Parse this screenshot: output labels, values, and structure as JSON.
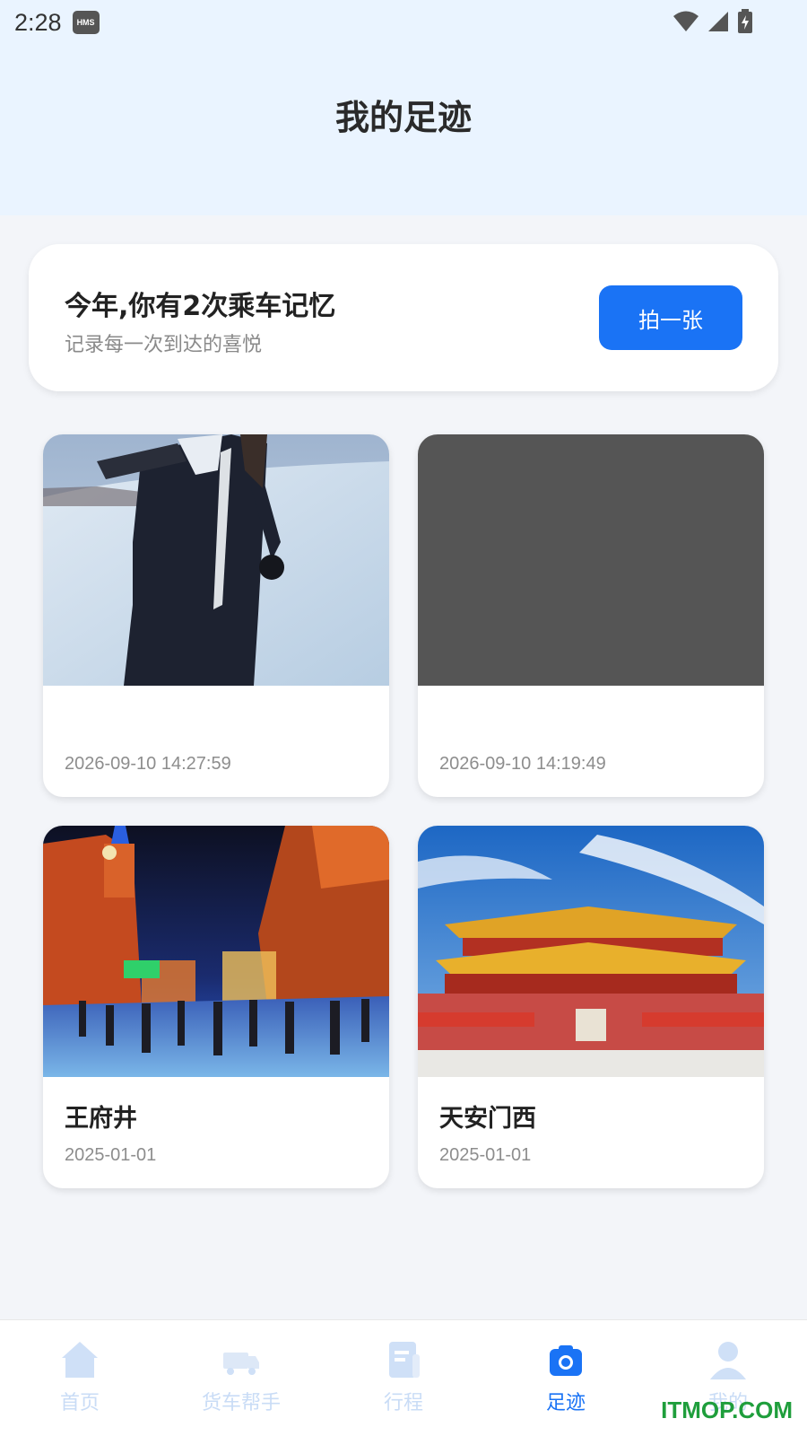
{
  "status_bar": {
    "time": "2:28",
    "badge": "HMS"
  },
  "header": {
    "title": "我的足迹"
  },
  "summary": {
    "title": "今年,你有2次乘车记忆",
    "subtitle": "记录每一次到达的喜悦",
    "button_label": "拍一张"
  },
  "cards": [
    {
      "name": "",
      "date": "2026-09-10 14:27:59",
      "photo": "snow-scene-photo"
    },
    {
      "name": "",
      "date": "2026-09-10 14:19:49",
      "photo": "placeholder-photo"
    },
    {
      "name": "王府井",
      "date": "2025-01-01",
      "photo": "wangfujing-street-photo"
    },
    {
      "name": "天安门西",
      "date": "2025-01-01",
      "photo": "tiananmen-photo"
    }
  ],
  "tabs": [
    {
      "label": "首页",
      "icon": "home-icon",
      "active": false
    },
    {
      "label": "货车帮手",
      "icon": "truck-icon",
      "active": false
    },
    {
      "label": "行程",
      "icon": "document-icon",
      "active": false
    },
    {
      "label": "足迹",
      "icon": "camera-icon",
      "active": true
    },
    {
      "label": "我的",
      "icon": "user-icon",
      "active": false
    }
  ],
  "watermark": "ITMOP.COM",
  "colors": {
    "accent": "#1a73f5",
    "header_bg": "#eaf4ff",
    "page_bg": "#f3f5f9"
  }
}
